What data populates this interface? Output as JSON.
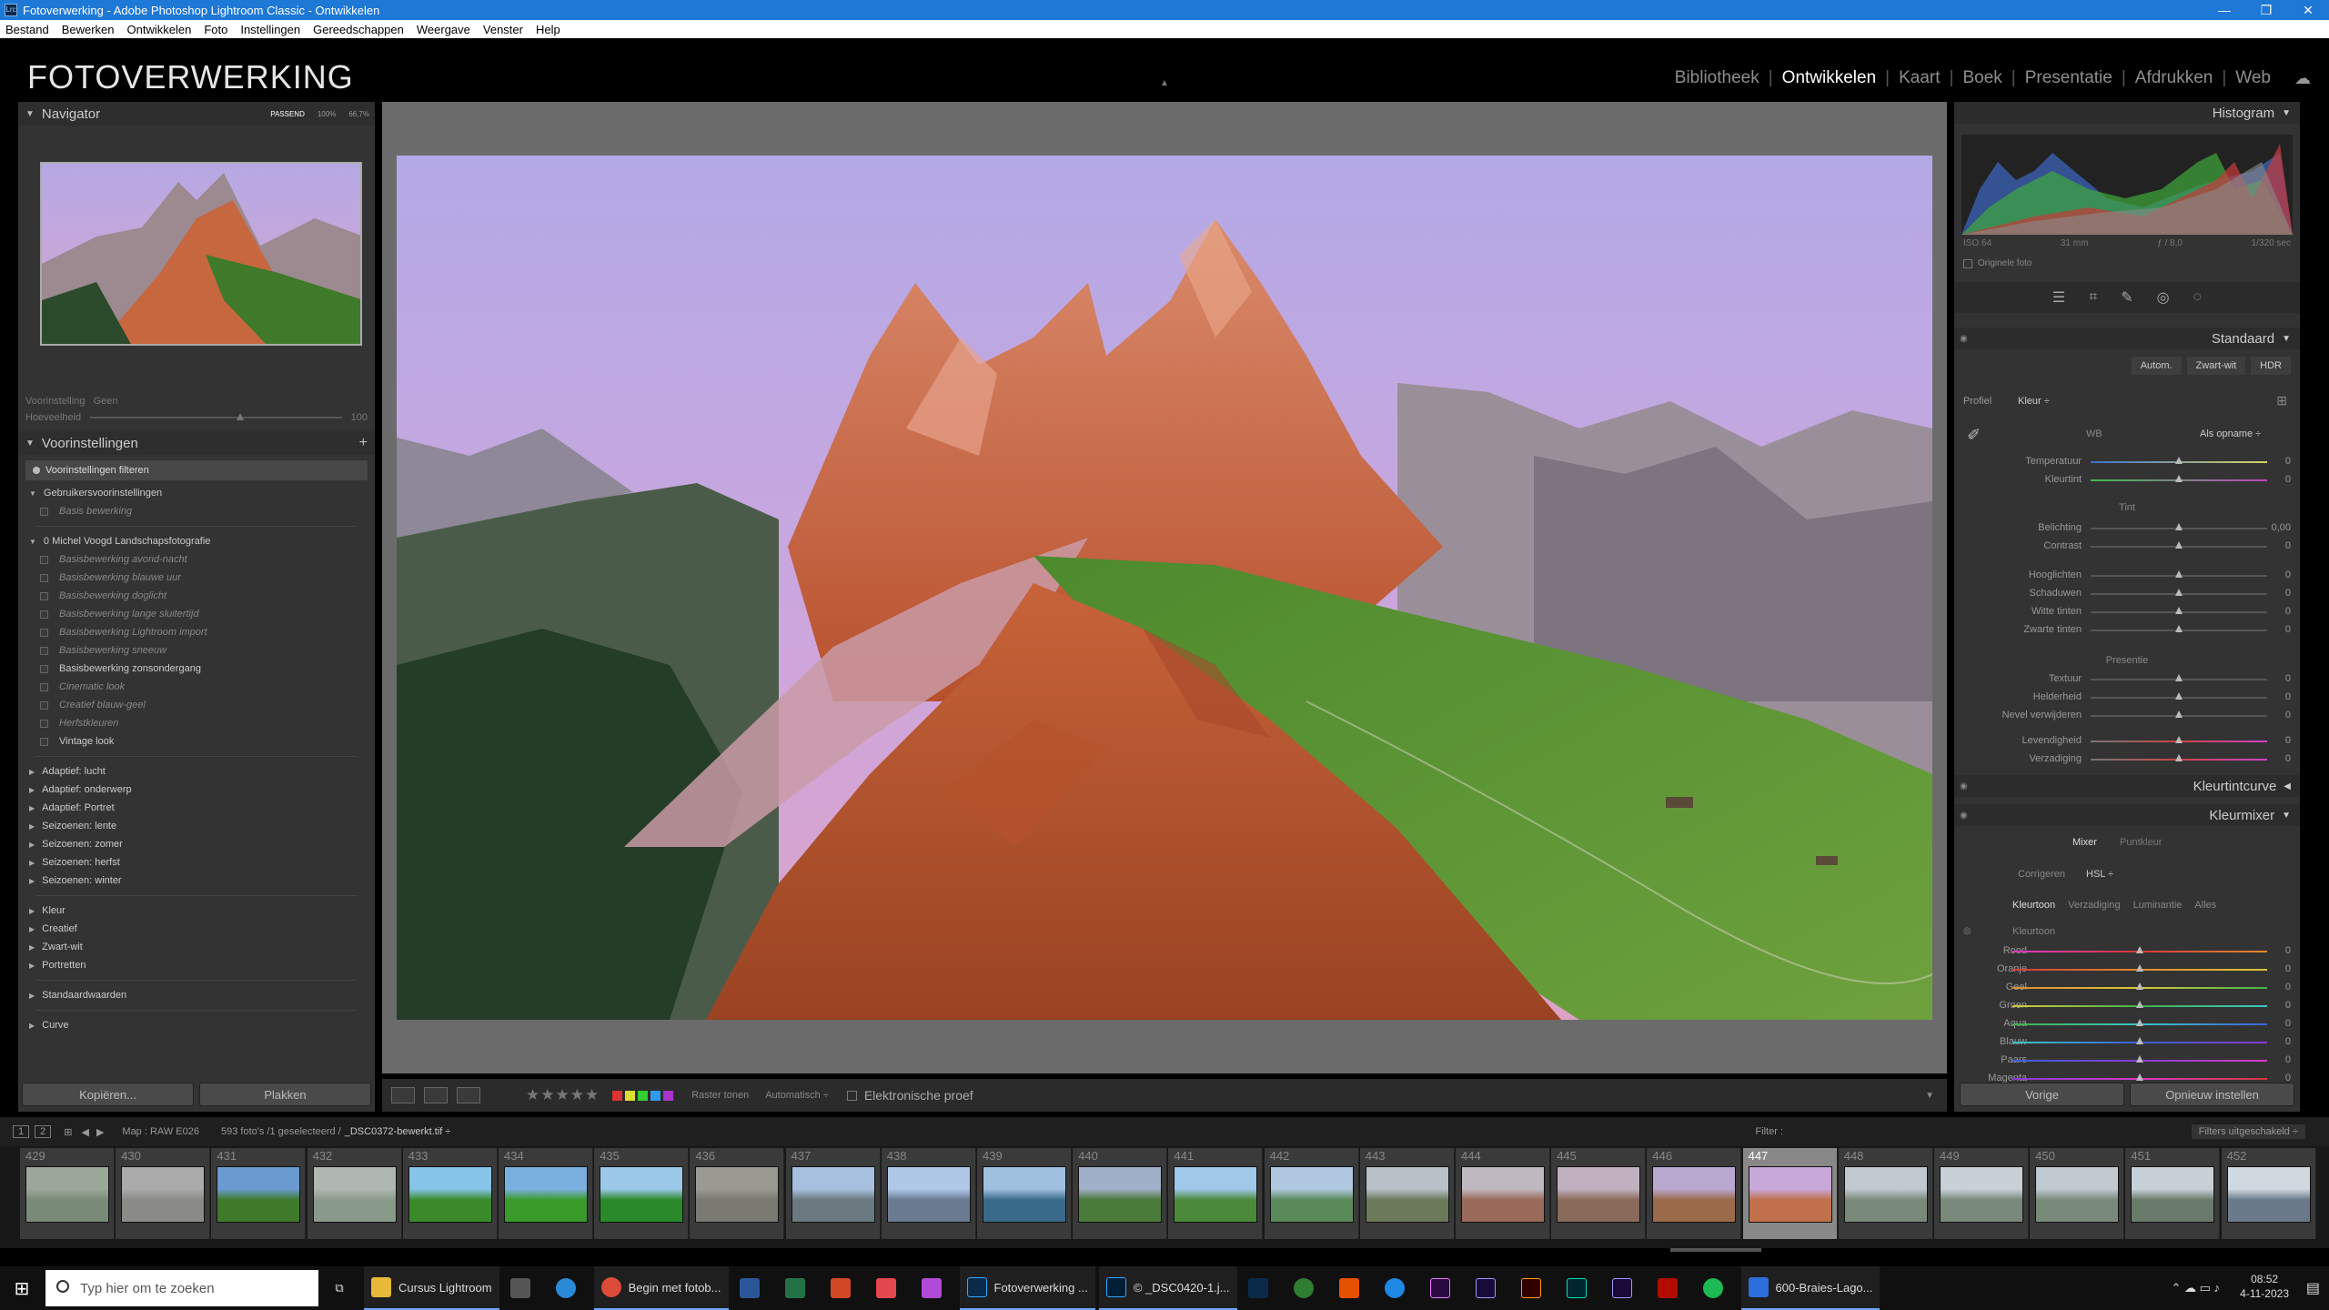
{
  "window": {
    "title": "Fotoverwerking - Adobe Photoshop Lightroom Classic - Ontwikkelen",
    "lr_glyph": "Lrc",
    "min": "—",
    "max": "❐",
    "close": "✕"
  },
  "menu": [
    "Bestand",
    "Bewerken",
    "Ontwikkelen",
    "Foto",
    "Instellingen",
    "Gereedschappen",
    "Weergave",
    "Venster",
    "Help"
  ],
  "identity": {
    "catalog": "FOTOVERWERKING",
    "modules": [
      "Bibliotheek",
      "Ontwikkelen",
      "Kaart",
      "Boek",
      "Presentatie",
      "Afdrukken",
      "Web"
    ],
    "active_module": "Ontwikkelen",
    "sep": "|"
  },
  "navigator": {
    "title": "Navigator",
    "zoom": [
      "PASSEND",
      "100%",
      "66,7%"
    ]
  },
  "preset_slot": {
    "label": "Voorinstelling",
    "value": "Geen",
    "amount_label": "Hoeveelheid",
    "amount": "100"
  },
  "presets": {
    "title": "Voorinstellingen",
    "add": "+",
    "filter": "Voorinstellingen filteren",
    "user_group": "Gebruikersvoorinstellingen",
    "user_items": [
      "Basis bewerking"
    ],
    "mv_group": "0 Michel Voogd Landschapsfotografie",
    "mv_items": [
      "Basisbewerking avond-nacht",
      "Basisbewerking blauwe uur",
      "Basisbewerking doglicht",
      "Basisbewerking lange sluitertijd",
      "Basisbewerking Lightroom import",
      "Basisbewerking sneeuw",
      "Basisbewerking zonsondergang",
      "Cinematic look",
      "Creatief blauw-geel",
      "Herfstkleuren",
      "Vintage look"
    ],
    "groups1": [
      "Adaptief: lucht",
      "Adaptief: onderwerp",
      "Adaptief: Portret",
      "Seizoenen: lente",
      "Seizoenen: zomer",
      "Seizoenen: herfst",
      "Seizoenen: winter"
    ],
    "groups2": [
      "Kleur",
      "Creatief",
      "Zwart-wit",
      "Portretten"
    ],
    "groups3": [
      "Standaardwaarden"
    ],
    "groups4": [
      "Curve"
    ]
  },
  "left_buttons": {
    "copy": "Kopiëren...",
    "paste": "Plakken"
  },
  "toolbar": {
    "stars": "★★★★★",
    "soft_proof": "Elektronische proef",
    "raster": "Raster tonen",
    "raster_mode": "Automatisch ÷",
    "swatches": [
      "#d33",
      "#dd3",
      "#3c3",
      "#39e",
      "#a3c"
    ]
  },
  "histogram": {
    "title": "Histogram",
    "iso": "ISO 64",
    "focal": "31 mm",
    "aperture": "ƒ / 8,0",
    "shutter": "1/320 sec",
    "original": "Originele foto"
  },
  "basic": {
    "title": "Standaard",
    "auto": "Autom.",
    "bw": "Zwart-wit",
    "hdr": "HDR",
    "profile_label": "Profiel",
    "profile": "Kleur ÷",
    "wb_label": "WB",
    "wb": "Als opname ÷",
    "tone_label": "Tint",
    "presence_label": "Presentie",
    "sliders": [
      {
        "label": "Temperatuur",
        "value": "0"
      },
      {
        "label": "Kleurtint",
        "value": "0"
      },
      {
        "label": "Belichting",
        "value": "0,00"
      },
      {
        "label": "Contrast",
        "value": "0"
      },
      {
        "label": "Hooglichten",
        "value": "0"
      },
      {
        "label": "Schaduwen",
        "value": "0"
      },
      {
        "label": "Witte tinten",
        "value": "0"
      },
      {
        "label": "Zwarte tinten",
        "value": "0"
      },
      {
        "label": "Textuur",
        "value": "0"
      },
      {
        "label": "Helderheid",
        "value": "0"
      },
      {
        "label": "Nevel verwijderen",
        "value": "0"
      },
      {
        "label": "Levendigheid",
        "value": "0"
      },
      {
        "label": "Verzadiging",
        "value": "0"
      }
    ]
  },
  "tonecurve": {
    "title": "Kleurtintcurve"
  },
  "mixer": {
    "title": "Kleurmixer",
    "tab_mixer": "Mixer",
    "tab_point": "Puntkleur",
    "adjust_label": "Corrigeren",
    "adjust": "HSL ÷",
    "tabs": [
      "Kleurtoon",
      "Verzadiging",
      "Luminantie",
      "Alles"
    ],
    "sub": "Kleurtoon",
    "sliders": [
      {
        "label": "Rood",
        "value": "0"
      },
      {
        "label": "Oranje",
        "value": "0"
      },
      {
        "label": "Geel",
        "value": "0"
      },
      {
        "label": "Groen",
        "value": "0"
      },
      {
        "label": "Aqua",
        "value": "0"
      },
      {
        "label": "Blauw",
        "value": "0"
      },
      {
        "label": "Paars",
        "value": "0"
      },
      {
        "label": "Magenta",
        "value": "0"
      }
    ]
  },
  "right_buttons": {
    "previous": "Vorige",
    "reset": "Opnieuw instellen"
  },
  "filmbar": {
    "page1": "1",
    "page2": "2",
    "source": "Map : RAW E026",
    "count": "593 foto's /1 geselecteerd /",
    "file": "_DSC0372-bewerkt.tif ÷",
    "filter": "Filter :",
    "filter_state": "Filters uitgeschakeld ÷"
  },
  "filmstrip": [
    "429",
    "430",
    "431",
    "432",
    "433",
    "434",
    "435",
    "436",
    "437",
    "438",
    "439",
    "440",
    "441",
    "442",
    "443",
    "444",
    "445",
    "446",
    "447",
    "448",
    "449",
    "450",
    "451",
    "452"
  ],
  "taskbar": {
    "search": "Typ hier om te zoeken",
    "apps": [
      "Cursus Lightroom",
      "Begin met fotob...",
      "Fotoverwerking ...",
      "© _DSC0420-1.j...",
      "600-Braies-Lago..."
    ],
    "time": "08:52",
    "date": "4-11-2023"
  }
}
